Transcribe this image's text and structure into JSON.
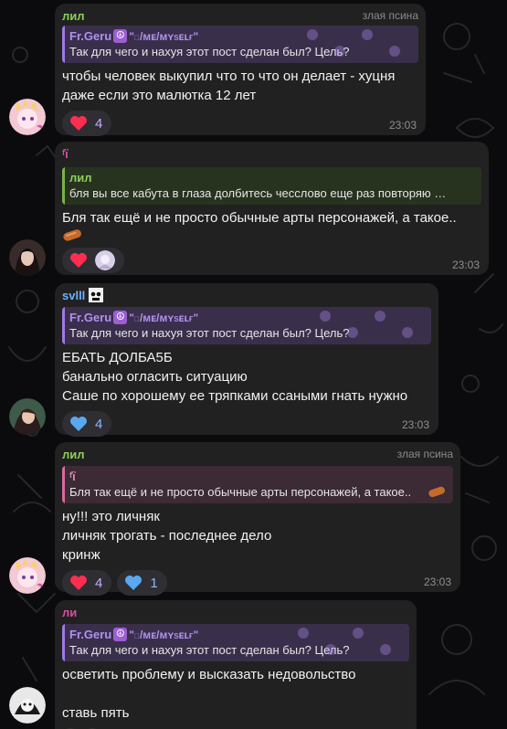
{
  "colors": {
    "background": "#0b0b0d",
    "bubble": "#212121",
    "name_green": "#8fce5c",
    "name_pink": "#d64fa0",
    "name_blue": "#6fb0ff",
    "reply_purple": "#b18ff0"
  },
  "messages": [
    {
      "sender": "лил",
      "badge": "злая псина",
      "reply_author": "Fr.Geru",
      "reply_author_suffix": "\"ɪ/ᴍᴇ/ᴍʏsᴇʟғ\"",
      "reply_text": "Так для чего и нахуя этот пост сделан был? Цель?",
      "lines": [
        "чтобы человек выкупил что то что он делает - хуцня",
        "даже если это малютка 12 лет"
      ],
      "reactions": [
        {
          "icon": "heart-icon",
          "count": "4"
        }
      ],
      "time": "23:03"
    },
    {
      "sender": "ᶠἳ",
      "reply_author": "лил",
      "reply_text": "бля вы все кабута в глаза долбитесь чесслово еще раз повторяю …",
      "lines": [
        "Бля так ещё и не просто обычные арты персонажей, а такое.."
      ],
      "reactions": [
        {
          "icon": "heart-icon",
          "count": ""
        }
      ],
      "time": "23:03"
    },
    {
      "sender": "svlll",
      "reply_author": "Fr.Geru",
      "reply_author_suffix": "\"ɪ/ᴍᴇ/ᴍʏsᴇʟғ\"",
      "reply_text": "Так для чего и нахуя этот пост сделан был? Цель?",
      "lines": [
        "ЕБАТЬ ДОЛБА5Б",
        "банально огласить ситуацию",
        "Саше по хорошему ее тряпками ссаными гнать нужно"
      ],
      "reactions": [
        {
          "icon": "blue-heart-icon",
          "count": "4"
        }
      ],
      "time": "23:03"
    },
    {
      "sender": "лил",
      "badge": "злая псина",
      "reply_author": "ᶠἳ",
      "reply_text": "Бля так ещё и не просто обычные арты персонажей, а такое..",
      "lines": [
        "ну!!! это личняк",
        "личняк трогать - последнее дело",
        "кринж"
      ],
      "reactions": [
        {
          "icon": "heart-icon",
          "count": "4"
        },
        {
          "icon": "blue-heart-icon",
          "count": "1"
        }
      ],
      "time": "23:03"
    },
    {
      "sender": "ли",
      "reply_author": "Fr.Geru",
      "reply_author_suffix": "\"ɪ/ᴍᴇ/ᴍʏsᴇʟғ\"",
      "reply_text": "Так для чего и нахуя этот пост сделан был? Цель?",
      "lines": [
        "осветить проблему и высказать недовольство",
        "",
        "ставь пять"
      ]
    }
  ]
}
